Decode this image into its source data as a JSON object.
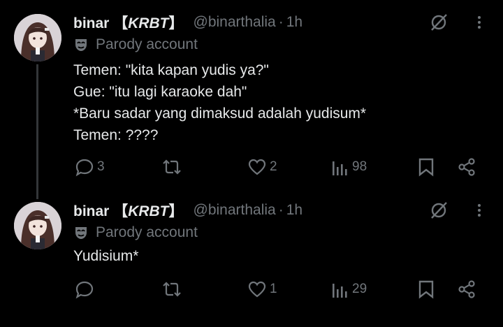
{
  "tweets": [
    {
      "name": "binar【KRBT】",
      "name_plain": "binar ",
      "name_bracket_open": "【",
      "name_tag": "KRBT",
      "name_bracket_close": "】",
      "handle": "@binarthalia",
      "dot": "·",
      "time": "1h",
      "badge": "Parody account",
      "badge_icon": "mask-icon",
      "lines": [
        "Temen: \"kita kapan yudis ya?\"",
        "Gue: \"itu lagi karaoke dah\"",
        "*Baru sadar yang dimaksud adalah yudisum*",
        "Temen: ????"
      ],
      "replies": "3",
      "reposts": "",
      "likes": "2",
      "views": "98"
    },
    {
      "name": "binar【KRBT】",
      "name_plain": "binar ",
      "name_bracket_open": "【",
      "name_tag": "KRBT",
      "name_bracket_close": "】",
      "handle": "@binarthalia",
      "dot": "·",
      "time": "1h",
      "badge": "Parody account",
      "badge_icon": "mask-icon",
      "lines": [
        "Yudisium*"
      ],
      "replies": "",
      "reposts": "",
      "likes": "1",
      "views": "29"
    }
  ],
  "colors": {
    "background": "#000000",
    "text": "#e7e9ea",
    "muted": "#71767b",
    "thread_line": "#333639"
  }
}
